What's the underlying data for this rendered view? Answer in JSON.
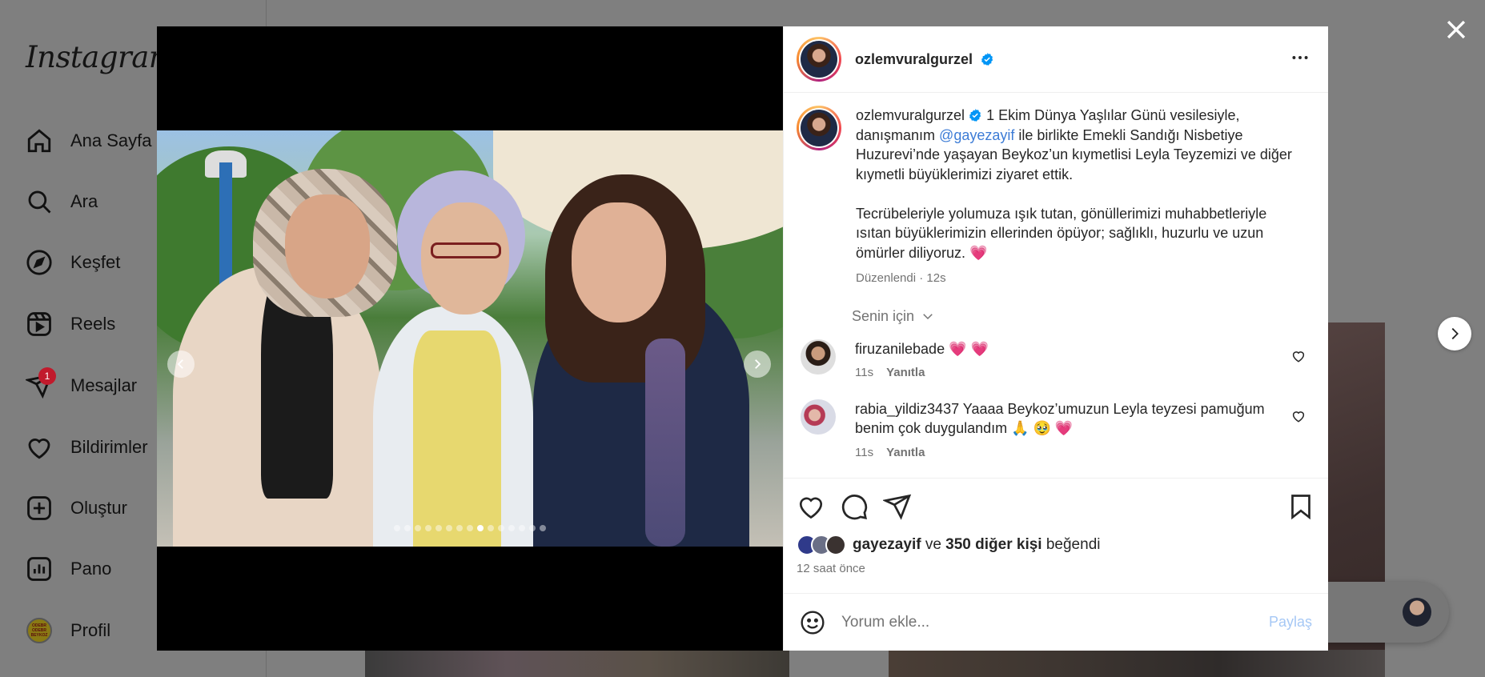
{
  "app": {
    "logo": "Instagram"
  },
  "sidebar": {
    "items": [
      {
        "label": "Ana Sayfa",
        "icon": "home-icon"
      },
      {
        "label": "Ara",
        "icon": "search-icon"
      },
      {
        "label": "Keşfet",
        "icon": "compass-icon"
      },
      {
        "label": "Reels",
        "icon": "reels-icon"
      },
      {
        "label": "Mesajlar",
        "icon": "messages-icon",
        "badge": "1"
      },
      {
        "label": "Bildirimler",
        "icon": "heart-icon"
      },
      {
        "label": "Oluştur",
        "icon": "plus-square-icon"
      },
      {
        "label": "Pano",
        "icon": "dashboard-icon"
      },
      {
        "label": "Profil",
        "icon": "profile-avatar"
      }
    ]
  },
  "post": {
    "author": "ozlemvuralgurzel",
    "verified": true,
    "caption": {
      "p1_before": " 1 Ekim Dünya Yaşlılar Günü vesilesiyle, danışmanım ",
      "mention": "@gayezayif",
      "p1_after": " ile birlikte Emekli Sandığı Nisbetiye Huzurevi’nde yaşayan Beykoz’un kıymetlisi Leyla Teyzemizi ve diğer kıymetli büyüklerimizi ziyaret ettik.",
      "p2": "Tecrübeleriyle yolumuza ışık tutan, gönüllerimizi muhabbetleriyle ısıtan büyüklerimizin ellerinden öpüyor; sağlıklı, huzurlu ve uzun ömürler diliyoruz. 💗"
    },
    "caption_meta": "Düzenlendi · 12s",
    "for_you_label": "Senin için",
    "carousel": {
      "count": 15,
      "active_index": 8
    },
    "comments": [
      {
        "user": "firuzanilebade",
        "text": " 💗 💗",
        "time": "11s",
        "reply": "Yanıtla"
      },
      {
        "user": "rabia_yildiz3437",
        "text": " Yaaaa Beykoz’umuzun Leyla teyzesi pamuğum benim çok duygulandım 🙏 🥹 💗",
        "time": "11s",
        "reply": "Yanıtla"
      }
    ],
    "likes": {
      "first_user": "gayezayif",
      "connector": " ve ",
      "others": "350 diğer kişi",
      "suffix": " beğendi"
    },
    "time_ago": "12 saat önce"
  },
  "comment_input": {
    "placeholder": "Yorum ekle...",
    "post_label": "Paylaş"
  },
  "colors": {
    "accent": "#0095f6",
    "mention": "#3d7cd6",
    "like_red": "#ed4956",
    "overlay": "#7f7f7f"
  }
}
